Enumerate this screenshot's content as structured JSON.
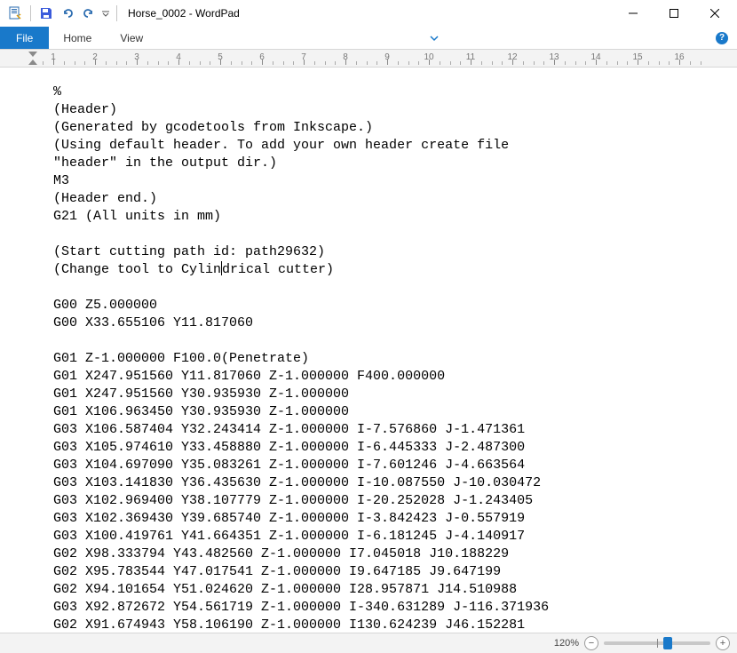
{
  "titlebar": {
    "title": "Horse_0002 - WordPad"
  },
  "tabs": {
    "file": "File",
    "home": "Home",
    "view": "View"
  },
  "ruler": {
    "labels": [
      "1",
      "2",
      "3",
      "4",
      "5",
      "6",
      "7",
      "8",
      "9",
      "10",
      "11",
      "12",
      "13",
      "14",
      "15",
      "16"
    ]
  },
  "document": {
    "lines": [
      "%",
      "(Header)",
      "(Generated by gcodetools from Inkscape.)",
      "(Using default header. To add your own header create file",
      "\"header\" in the output dir.)",
      "M3",
      "(Header end.)",
      "G21 (All units in mm)",
      "",
      "(Start cutting path id: path29632)",
      "(Change tool to Cylindrical cutter)",
      "",
      "G00 Z5.000000",
      "G00 X33.655106 Y11.817060",
      "",
      "G01 Z-1.000000 F100.0(Penetrate)",
      "G01 X247.951560 Y11.817060 Z-1.000000 F400.000000",
      "G01 X247.951560 Y30.935930 Z-1.000000",
      "G01 X106.963450 Y30.935930 Z-1.000000",
      "G03 X106.587404 Y32.243414 Z-1.000000 I-7.576860 J-1.471361",
      "G03 X105.974610 Y33.458880 Z-1.000000 I-6.445333 J-2.487300",
      "G03 X104.697090 Y35.083261 Z-1.000000 I-7.601246 J-4.663564",
      "G03 X103.141830 Y36.435630 Z-1.000000 I-10.087550 J-10.030472",
      "G03 X102.969400 Y38.107779 Z-1.000000 I-20.252028 J-1.243405",
      "G03 X102.369430 Y39.685740 Z-1.000000 I-3.842423 J-0.557919",
      "G03 X100.419761 Y41.664351 Z-1.000000 I-6.181245 J-4.140917",
      "G02 X98.333794 Y43.482560 Z-1.000000 I7.045018 J10.188229",
      "G02 X95.783544 Y47.017541 Z-1.000000 I9.647185 J9.647199",
      "G02 X94.101654 Y51.024620 Z-1.000000 I28.957871 J14.510988",
      "G03 X92.872672 Y54.561719 Z-1.000000 I-340.631289 J-116.371936",
      "G02 X91.674943 Y58.106190 Z-1.000000 I130.624239 J46.152281"
    ],
    "caret_line": 10,
    "caret_col": 21
  },
  "status": {
    "zoom": "120%",
    "thumb_pct": 60
  }
}
